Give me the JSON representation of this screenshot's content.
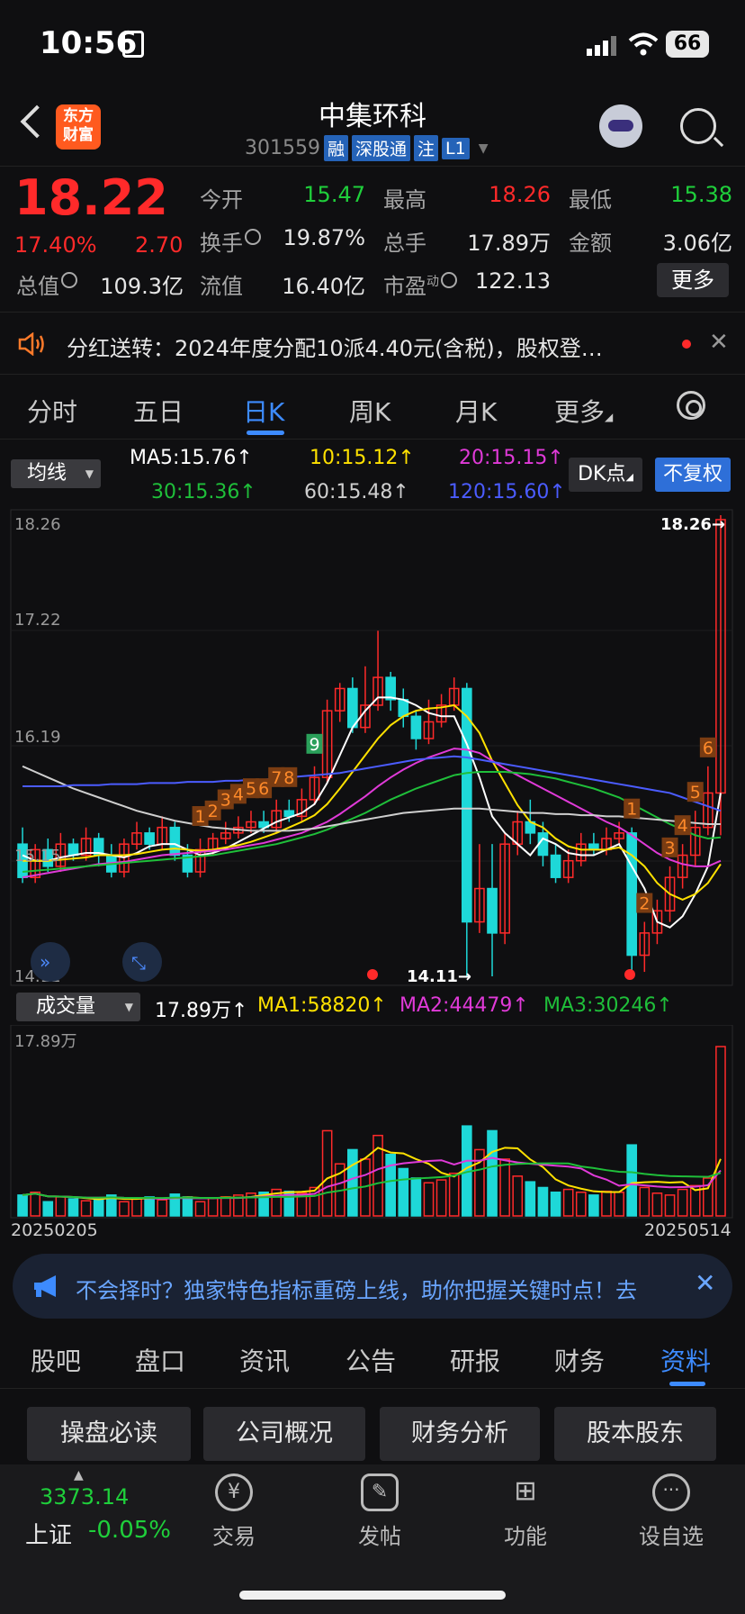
{
  "status": {
    "time": "10:56",
    "battery": "66"
  },
  "header": {
    "logo": "东方财富",
    "name": "中集环科",
    "code": "301559",
    "tags": [
      "融",
      "深股通",
      "注",
      "L1"
    ]
  },
  "quote": {
    "price": "18.22",
    "pct": "17.40%",
    "change": "2.70",
    "fields": [
      {
        "label": "今开",
        "value": "15.47",
        "color": "#1fcf3b"
      },
      {
        "label": "最高",
        "value": "18.26",
        "color": "#ff2a2a"
      },
      {
        "label": "最低",
        "value": "15.38",
        "color": "#1fcf3b"
      },
      {
        "label": "换手",
        "value": "19.87%",
        "color": "#e6e6e6"
      },
      {
        "label": "总手",
        "value": "17.89万",
        "color": "#e6e6e6"
      },
      {
        "label": "金额",
        "value": "3.06亿",
        "color": "#e6e6e6"
      },
      {
        "label": "总值",
        "value": "109.3亿",
        "color": "#e6e6e6"
      },
      {
        "label": "流值",
        "value": "16.40亿",
        "color": "#e6e6e6"
      },
      {
        "label": "市盈",
        "sup": "动",
        "value": "122.13",
        "color": "#e6e6e6"
      }
    ],
    "more": "更多"
  },
  "notice": {
    "text": "分红送转：2024年度分配10派4.40元(含税)，股权登…"
  },
  "period_tabs": {
    "items": [
      "分时",
      "五日",
      "日K",
      "周K",
      "月K",
      "更多"
    ],
    "active": 2
  },
  "ma": {
    "select": "均线",
    "values": [
      {
        "text": "MA5:15.76↑",
        "color": "#ffffff"
      },
      {
        "text": "10:15.12↑",
        "color": "#ffe100"
      },
      {
        "text": "20:15.15↑",
        "color": "#e03ad8"
      },
      {
        "text": "30:15.36↑",
        "color": "#1fbf3a"
      },
      {
        "text": "60:15.48↑",
        "color": "#cfcfcf"
      },
      {
        "text": "120:15.60↑",
        "color": "#4b5cff"
      }
    ],
    "dk": "DK点",
    "fq": "不复权"
  },
  "chart_data": {
    "type": "candlestick",
    "y_ticks": [
      "18.26",
      "17.22",
      "16.19",
      "15.15",
      "14.11"
    ],
    "ylim": [
      14.11,
      18.26
    ],
    "high_label": "18.26→",
    "low_label": "14.11→",
    "x_labels": [
      "20250205",
      "20250514"
    ],
    "markers": [
      "1",
      "2",
      "3",
      "4",
      "5",
      "6",
      "7",
      "8",
      "9",
      "1",
      "2",
      "3",
      "4",
      "5",
      "6"
    ],
    "candles": [
      [
        15.3,
        15.0,
        15.45,
        14.95
      ],
      [
        15.0,
        15.25,
        15.3,
        14.95
      ],
      [
        15.25,
        15.1,
        15.35,
        15.05
      ],
      [
        15.1,
        15.3,
        15.4,
        15.05
      ],
      [
        15.3,
        15.2,
        15.35,
        15.15
      ],
      [
        15.2,
        15.35,
        15.45,
        15.15
      ],
      [
        15.35,
        15.2,
        15.4,
        15.1
      ],
      [
        15.2,
        15.05,
        15.3,
        15.0
      ],
      [
        15.05,
        15.3,
        15.35,
        15.0
      ],
      [
        15.3,
        15.4,
        15.5,
        15.25
      ],
      [
        15.4,
        15.3,
        15.45,
        15.25
      ],
      [
        15.3,
        15.45,
        15.55,
        15.25
      ],
      [
        15.45,
        15.2,
        15.5,
        15.15
      ],
      [
        15.2,
        15.05,
        15.3,
        15.0
      ],
      [
        15.05,
        15.25,
        15.35,
        15.0
      ],
      [
        15.25,
        15.35,
        15.4,
        15.2
      ],
      [
        15.35,
        15.4,
        15.5,
        15.3
      ],
      [
        15.4,
        15.45,
        15.55,
        15.35
      ],
      [
        15.45,
        15.5,
        15.6,
        15.4
      ],
      [
        15.5,
        15.45,
        15.6,
        15.4
      ],
      [
        15.45,
        15.6,
        15.7,
        15.4
      ],
      [
        15.6,
        15.55,
        15.7,
        15.5
      ],
      [
        15.55,
        15.7,
        15.8,
        15.5
      ],
      [
        15.7,
        15.9,
        16.0,
        15.65
      ],
      [
        15.9,
        16.5,
        16.6,
        15.85
      ],
      [
        16.5,
        16.7,
        16.75,
        16.4
      ],
      [
        16.7,
        16.35,
        16.8,
        16.3
      ],
      [
        16.35,
        16.55,
        16.9,
        16.3
      ],
      [
        16.55,
        16.8,
        17.22,
        16.5
      ],
      [
        16.8,
        16.6,
        16.85,
        16.5
      ],
      [
        16.6,
        16.45,
        16.7,
        16.35
      ],
      [
        16.45,
        16.25,
        16.5,
        16.15
      ],
      [
        16.25,
        16.4,
        16.6,
        16.2
      ],
      [
        16.4,
        16.55,
        16.65,
        16.35
      ],
      [
        16.55,
        16.7,
        16.8,
        16.5
      ],
      [
        16.7,
        14.6,
        16.75,
        14.11
      ],
      [
        14.6,
        14.9,
        15.3,
        14.5
      ],
      [
        14.9,
        14.5,
        15.3,
        14.11
      ],
      [
        14.5,
        15.3,
        15.4,
        14.4
      ],
      [
        15.3,
        15.5,
        15.6,
        15.2
      ],
      [
        15.5,
        15.4,
        15.7,
        15.3
      ],
      [
        15.4,
        15.2,
        15.5,
        15.1
      ],
      [
        15.2,
        15.0,
        15.3,
        14.95
      ],
      [
        15.0,
        15.15,
        15.25,
        14.95
      ],
      [
        15.15,
        15.3,
        15.4,
        15.1
      ],
      [
        15.3,
        15.25,
        15.4,
        15.2
      ],
      [
        15.25,
        15.35,
        15.45,
        15.2
      ],
      [
        15.35,
        15.4,
        15.5,
        15.3
      ],
      [
        15.4,
        14.3,
        15.45,
        14.15
      ],
      [
        14.3,
        14.5,
        14.6,
        14.15
      ],
      [
        14.5,
        14.7,
        14.8,
        14.4
      ],
      [
        14.7,
        15.0,
        15.1,
        14.6
      ],
      [
        15.0,
        15.2,
        15.3,
        14.9
      ],
      [
        15.2,
        15.45,
        15.6,
        15.1
      ],
      [
        15.45,
        15.76,
        16.0,
        15.38
      ],
      [
        15.76,
        18.22,
        18.26,
        15.38
      ]
    ],
    "ma_lines": [
      {
        "name": "MA5",
        "color": "#ffffff",
        "values": [
          15.2,
          15.15,
          15.15,
          15.18,
          15.2,
          15.22,
          15.22,
          15.2,
          15.18,
          15.22,
          15.28,
          15.3,
          15.3,
          15.25,
          15.2,
          15.22,
          15.26,
          15.32,
          15.38,
          15.44,
          15.5,
          15.54,
          15.58,
          15.66,
          15.85,
          16.1,
          16.35,
          16.5,
          16.62,
          16.62,
          16.6,
          16.55,
          16.48,
          16.45,
          16.45,
          16.2,
          15.9,
          15.55,
          15.4,
          15.3,
          15.2,
          15.35,
          15.3,
          15.22,
          15.2,
          15.2,
          15.25,
          15.3,
          15.1,
          14.9,
          14.6,
          14.55,
          14.65,
          14.85,
          15.1,
          15.76
        ]
      },
      {
        "name": "MA10",
        "color": "#ffe100",
        "values": [
          15.15,
          15.15,
          15.15,
          15.16,
          15.17,
          15.18,
          15.2,
          15.2,
          15.2,
          15.21,
          15.23,
          15.25,
          15.26,
          15.25,
          15.24,
          15.25,
          15.27,
          15.29,
          15.32,
          15.36,
          15.4,
          15.45,
          15.5,
          15.56,
          15.66,
          15.8,
          15.95,
          16.1,
          16.25,
          16.37,
          16.45,
          16.5,
          16.52,
          16.53,
          16.55,
          16.45,
          16.3,
          16.05,
          15.85,
          15.65,
          15.5,
          15.45,
          15.35,
          15.28,
          15.25,
          15.25,
          15.25,
          15.27,
          15.2,
          15.1,
          14.95,
          14.85,
          14.8,
          14.85,
          14.95,
          15.12
        ]
      },
      {
        "name": "MA20",
        "color": "#e03ad8",
        "values": [
          15.0,
          15.02,
          15.04,
          15.06,
          15.08,
          15.1,
          15.12,
          15.13,
          15.14,
          15.16,
          15.18,
          15.2,
          15.21,
          15.22,
          15.23,
          15.24,
          15.25,
          15.27,
          15.29,
          15.31,
          15.34,
          15.37,
          15.4,
          15.45,
          15.5,
          15.57,
          15.65,
          15.73,
          15.82,
          15.9,
          15.97,
          16.03,
          16.08,
          16.12,
          16.16,
          16.15,
          16.12,
          16.05,
          15.98,
          15.92,
          15.86,
          15.8,
          15.74,
          15.68,
          15.62,
          15.56,
          15.5,
          15.45,
          15.38,
          15.3,
          15.22,
          15.16,
          15.12,
          15.1,
          15.1,
          15.15
        ]
      },
      {
        "name": "MA30",
        "color": "#1fbf3a",
        "values": [
          15.05,
          15.06,
          15.07,
          15.08,
          15.09,
          15.1,
          15.11,
          15.12,
          15.13,
          15.14,
          15.15,
          15.16,
          15.17,
          15.18,
          15.19,
          15.2,
          15.22,
          15.24,
          15.26,
          15.28,
          15.3,
          15.33,
          15.36,
          15.39,
          15.43,
          15.48,
          15.53,
          15.58,
          15.64,
          15.7,
          15.75,
          15.8,
          15.84,
          15.88,
          15.92,
          15.94,
          15.95,
          15.95,
          15.95,
          15.94,
          15.93,
          15.91,
          15.89,
          15.86,
          15.83,
          15.8,
          15.76,
          15.72,
          15.66,
          15.6,
          15.54,
          15.48,
          15.43,
          15.38,
          15.35,
          15.36
        ]
      },
      {
        "name": "MA60",
        "color": "#cfcfcf",
        "values": [
          16.0,
          15.95,
          15.9,
          15.85,
          15.8,
          15.76,
          15.72,
          15.68,
          15.64,
          15.6,
          15.57,
          15.54,
          15.51,
          15.49,
          15.47,
          15.45,
          15.44,
          15.43,
          15.42,
          15.42,
          15.42,
          15.42,
          15.43,
          15.44,
          15.46,
          15.48,
          15.5,
          15.52,
          15.54,
          15.56,
          15.58,
          15.59,
          15.6,
          15.61,
          15.62,
          15.62,
          15.62,
          15.61,
          15.6,
          15.59,
          15.58,
          15.58,
          15.57,
          15.57,
          15.56,
          15.56,
          15.55,
          15.55,
          15.54,
          15.53,
          15.52,
          15.51,
          15.5,
          15.49,
          15.48,
          15.48
        ]
      },
      {
        "name": "MA120",
        "color": "#4b5cff",
        "values": [
          15.82,
          15.82,
          15.82,
          15.82,
          15.83,
          15.83,
          15.83,
          15.84,
          15.84,
          15.84,
          15.85,
          15.85,
          15.85,
          15.86,
          15.86,
          15.86,
          15.87,
          15.87,
          15.88,
          15.88,
          15.89,
          15.9,
          15.91,
          15.92,
          15.93,
          15.94,
          15.96,
          15.98,
          16.0,
          16.02,
          16.04,
          16.06,
          16.07,
          16.08,
          16.09,
          16.08,
          16.06,
          16.04,
          16.02,
          16.0,
          15.98,
          15.96,
          15.94,
          15.92,
          15.9,
          15.88,
          15.86,
          15.84,
          15.82,
          15.8,
          15.78,
          15.76,
          15.72,
          15.68,
          15.64,
          15.6
        ]
      }
    ]
  },
  "volume": {
    "select": "成交量",
    "values": [
      {
        "text": "17.89万↑",
        "color": "#ffffff"
      },
      {
        "text": "MA1:58820↑",
        "color": "#ffe100"
      },
      {
        "text": "MA2:44479↑",
        "color": "#e03ad8"
      },
      {
        "text": "MA3:30246↑",
        "color": "#1fbf3a"
      }
    ],
    "max_label": "17.89万",
    "bars": [
      2.2,
      2.5,
      1.5,
      2.0,
      1.8,
      1.6,
      1.9,
      2.2,
      1.5,
      1.8,
      2.0,
      1.7,
      2.3,
      2.0,
      1.5,
      1.9,
      2.0,
      2.2,
      2.4,
      2.5,
      2.8,
      2.6,
      2.4,
      3.0,
      9.0,
      5.5,
      7.0,
      6.0,
      8.5,
      6.5,
      5.0,
      4.0,
      3.5,
      3.8,
      4.5,
      9.5,
      7.0,
      9.0,
      6.0,
      4.2,
      3.6,
      3.0,
      2.5,
      2.8,
      2.5,
      2.2,
      2.6,
      2.5,
      7.5,
      3.0,
      2.4,
      2.2,
      2.8,
      3.2,
      4.0,
      17.89
    ],
    "up": [
      false,
      true,
      false,
      true,
      false,
      true,
      false,
      false,
      true,
      true,
      false,
      true,
      false,
      false,
      true,
      true,
      true,
      true,
      true,
      false,
      true,
      false,
      true,
      true,
      true,
      true,
      false,
      true,
      true,
      false,
      false,
      false,
      true,
      true,
      true,
      false,
      true,
      false,
      true,
      true,
      false,
      false,
      false,
      true,
      true,
      false,
      true,
      true,
      false,
      true,
      true,
      true,
      true,
      true,
      true,
      true
    ]
  },
  "promo": {
    "text": "不会择时？独家特色指标重磅上线，助你把握关键时点！去"
  },
  "info_tabs": {
    "items": [
      "股吧",
      "盘口",
      "资讯",
      "公告",
      "研报",
      "财务",
      "资料"
    ],
    "active": 6
  },
  "sub_buttons": [
    "操盘必读",
    "公司概况",
    "财务分析",
    "股本股东"
  ],
  "footer": {
    "index_value": "3373.14",
    "index_name": "上证",
    "index_pct": "-0.05%",
    "buttons": [
      {
        "label": "交易",
        "icon": "yuan-exchange-icon"
      },
      {
        "label": "发帖",
        "icon": "edit-icon"
      },
      {
        "label": "功能",
        "icon": "grid-icon"
      },
      {
        "label": "设自选",
        "icon": "more-icon"
      }
    ]
  }
}
